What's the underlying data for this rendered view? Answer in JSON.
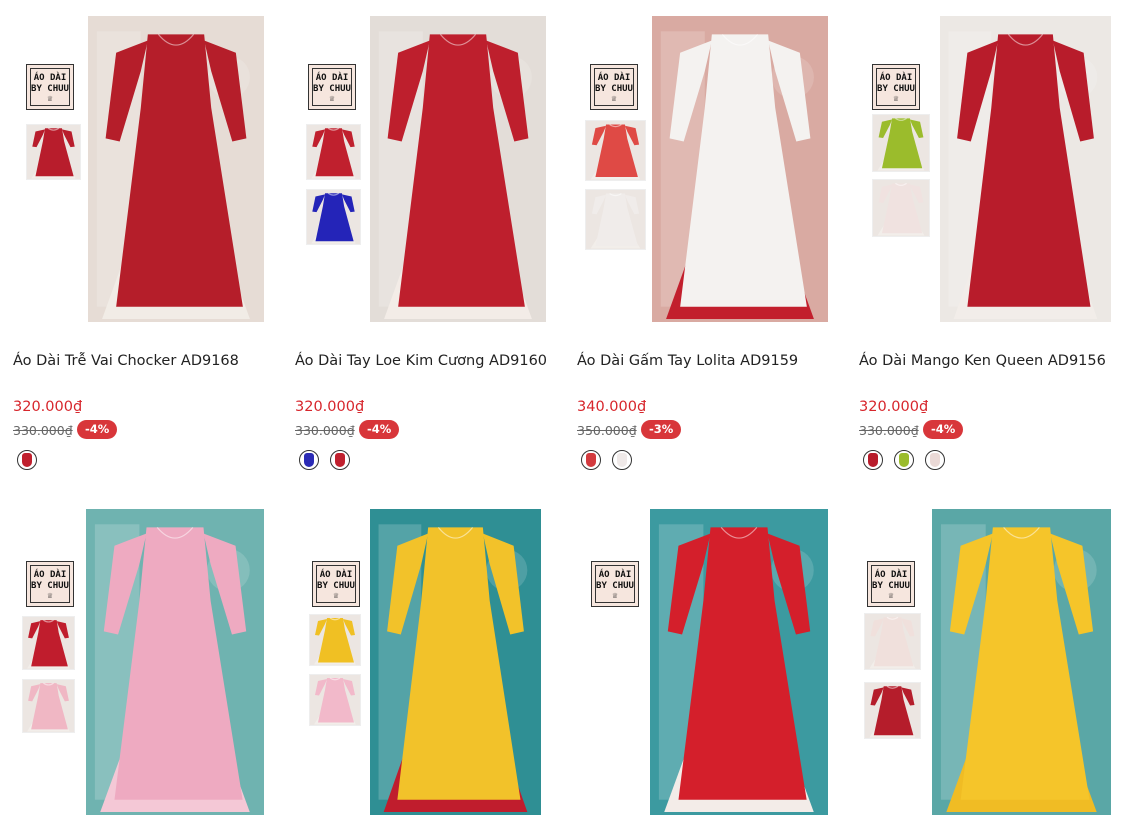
{
  "brand": {
    "logo_line1": "ÁO DÀI",
    "logo_line2": "BY CHUU",
    "logo_crown": "♕"
  },
  "products": [
    {
      "name": "Áo Dài Trễ Vai Chocker AD9168",
      "price": "320.000₫",
      "old_price": "330.000₫",
      "discount": "-4%",
      "main_color": "#b51e2a",
      "under_color": "#f1ece6",
      "bg_color": "#e6dcd5",
      "thumb_colors": [
        "#b81d2c"
      ],
      "swatch_colors": [
        "#c0202e"
      ]
    },
    {
      "name": "Áo Dài Tay Loe Kim Cương AD9160",
      "price": "320.000₫",
      "old_price": "330.000₫",
      "discount": "-4%",
      "main_color": "#be1f2d",
      "under_color": "#f3ece7",
      "bg_color": "#e3ddd8",
      "thumb_colors": [
        "#c0202e",
        "#2424b8"
      ],
      "swatch_colors": [
        "#2b2bb5",
        "#c0202e"
      ]
    },
    {
      "name": "Áo Dài Gấm Tay Lolita AD9159",
      "price": "340.000₫",
      "old_price": "350.000₫",
      "discount": "-3%",
      "main_color": "#f4f2f0",
      "under_color": "#c21f2d",
      "bg_color": "#d9aaa2",
      "thumb_colors": [
        "#df4a45",
        "#f0ecea"
      ],
      "swatch_colors": [
        "#d33a3e",
        "#efe9e8"
      ]
    },
    {
      "name": "Áo Dài Mango Ken Queen AD9156",
      "price": "320.000₫",
      "old_price": "330.000₫",
      "discount": "-4%",
      "main_color": "#b81c2b",
      "under_color": "#f2ede9",
      "bg_color": "#ece8e4",
      "thumb_colors": [
        "#9bbc2c",
        "#f0e2e0"
      ],
      "swatch_colors": [
        "#b81c2b",
        "#9bbc2c",
        "#ead9d6"
      ]
    },
    {
      "main_color": "#eeaac1",
      "under_color": "#f4c8d6",
      "bg_color": "#6fb3b0",
      "thumb_colors": [
        "#c01d2d",
        "#f0b7c4"
      ]
    },
    {
      "main_color": "#f2c22a",
      "under_color": "#c01d2d",
      "bg_color": "#2f8f94",
      "thumb_colors": [
        "#f0c023",
        "#f2b9ca"
      ]
    },
    {
      "main_color": "#d41f2b",
      "under_color": "#f3ece8",
      "bg_color": "#3c9aa0",
      "thumb_colors": []
    },
    {
      "main_color": "#f5c52a",
      "under_color": "#f0bc24",
      "bg_color": "#5aa7a6",
      "thumb_colors": [
        "#f0e0dc",
        "#b51d2b"
      ]
    }
  ]
}
